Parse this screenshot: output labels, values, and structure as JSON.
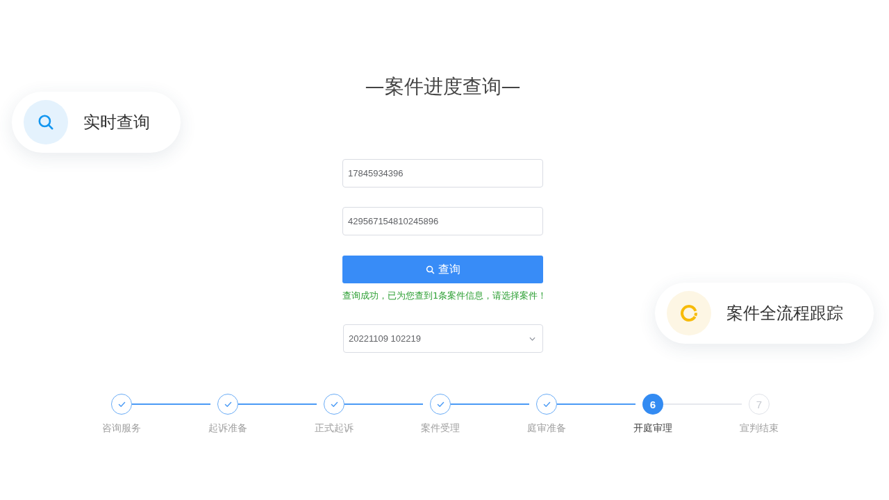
{
  "title": "—案件进度查询—",
  "feature_badges": [
    {
      "kind": "search",
      "label": "实时查询"
    },
    {
      "kind": "progress",
      "label": "案件全流程跟踪"
    }
  ],
  "query_form": {
    "fields": [
      {
        "value": "17845934396"
      },
      {
        "value": "429567154810245896"
      }
    ],
    "button": "查询",
    "message": "查询成功，已为您查到1条案件信息，请选择案件！",
    "case_select": {
      "value": "20221109 102219"
    }
  },
  "steps": [
    {
      "label": "咨询服务",
      "kind": "done"
    },
    {
      "label": "起诉准备",
      "kind": "done"
    },
    {
      "label": "正式起诉",
      "kind": "done"
    },
    {
      "label": "案件受理",
      "kind": "done"
    },
    {
      "label": "庭审准备",
      "kind": "done"
    },
    {
      "label": "开庭审理",
      "kind": "active",
      "number": "6"
    },
    {
      "label": "宣判结束",
      "kind": "pending",
      "number": "7"
    }
  ]
}
